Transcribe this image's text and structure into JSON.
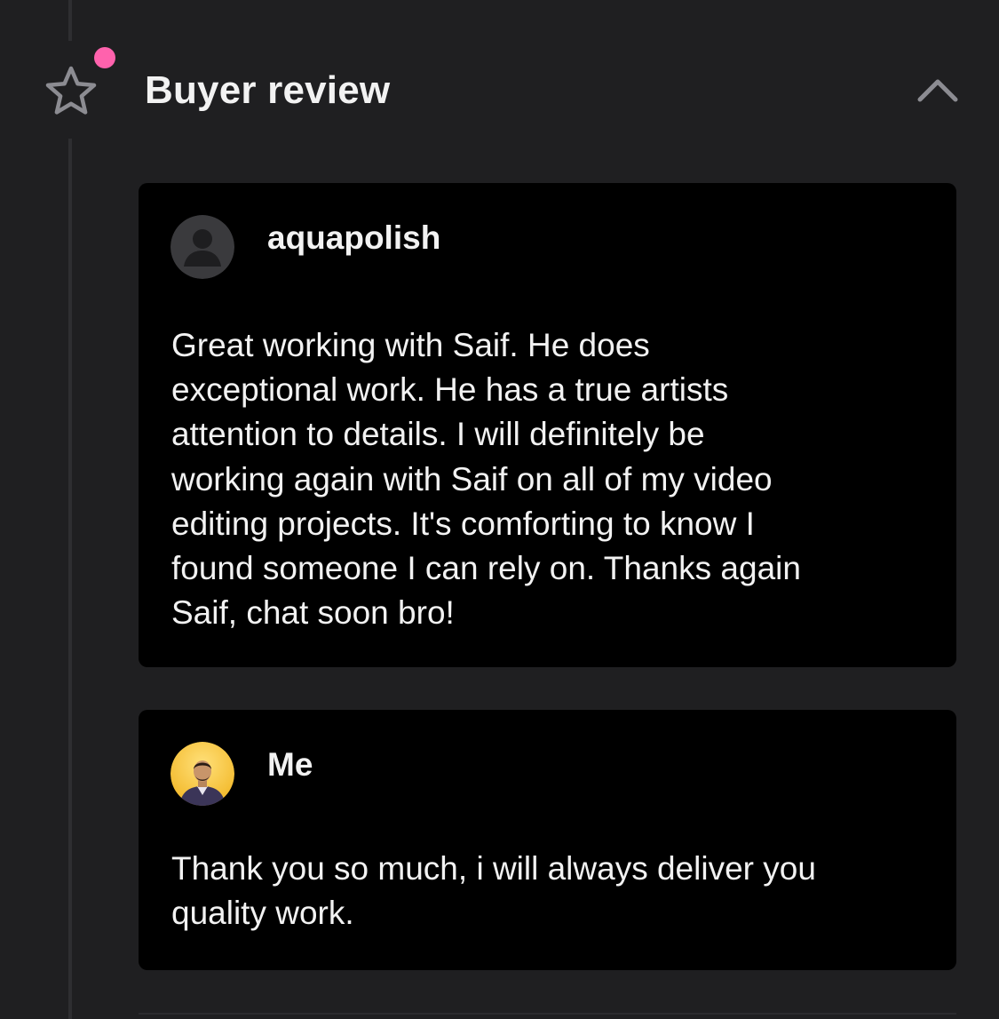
{
  "section": {
    "title": "Buyer review",
    "icon": "star-icon",
    "collapse_icon": "chevron-up-icon",
    "notification_color": "#ff62ad"
  },
  "review": {
    "author": "aquapolish",
    "avatar": "default-avatar-icon",
    "text": "Great working with Saif.  He does\nexceptional work.  He has a true artists\nattention to details.  I will definitely be\nworking again with Saif on all of my video\nediting projects.  It's comforting to know I\nfound someone I can rely on.  Thanks again\nSaif, chat soon bro!"
  },
  "reply": {
    "author": "Me",
    "avatar": "profile-photo",
    "text": "Thank you so much, i will always deliver you\nquality work."
  },
  "colors": {
    "background": "#1f1f21",
    "card": "#000000",
    "accent": "#ff62ad",
    "text": "#f2f2f2"
  }
}
